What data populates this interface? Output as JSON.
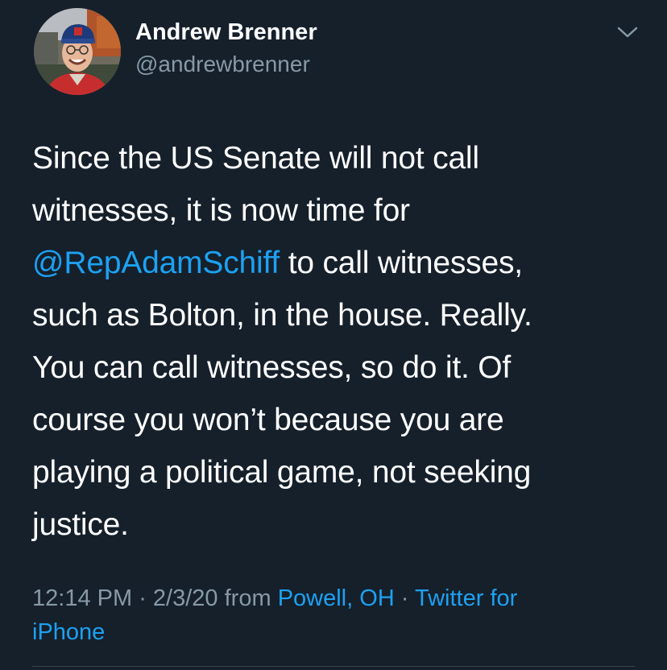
{
  "author": {
    "display_name": "Andrew Brenner",
    "handle": "@andrewbrenner",
    "avatar_icon": "profile-photo"
  },
  "menu": {
    "icon": "chevron-down-icon"
  },
  "tweet": {
    "line1": "Since the US Senate will not call",
    "line2": "witnesses, it is now time for",
    "mention": "@RepAdamSchiff",
    "line3_rest": " to call witnesses,",
    "line4": "such as Bolton, in the house. Really.",
    "line5": "You can call witnesses, so do it. Of",
    "line6": "course you won’t because you are",
    "line7": "playing a political game, not seeking",
    "line8": "justice."
  },
  "meta": {
    "time": "12:14 PM",
    "sep1": " · ",
    "date": "2/3/20",
    "from_text": " from ",
    "location": "Powell, OH",
    "sep2": " · ",
    "source_part1": "Twitter for",
    "source_part2": "iPhone"
  },
  "colors": {
    "background": "#15202b",
    "link": "#1da1f2",
    "secondary_text": "#8899a6",
    "primary_text": "#ffffff"
  }
}
